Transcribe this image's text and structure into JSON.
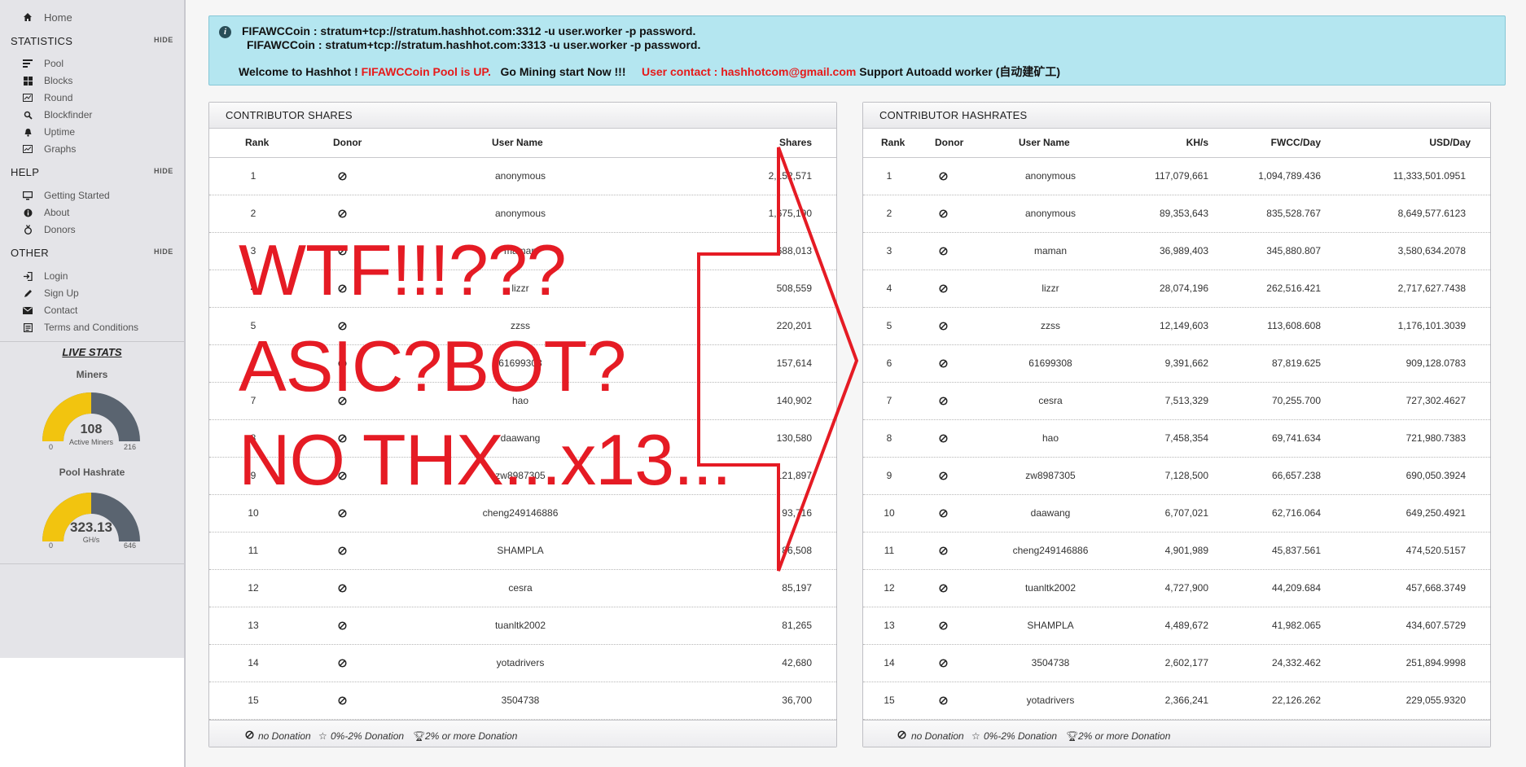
{
  "sidebar": {
    "home": "Home",
    "sections": [
      {
        "title": "STATISTICS",
        "hide": "HIDE",
        "items": [
          {
            "label": "Pool",
            "icon": "list-icon"
          },
          {
            "label": "Blocks",
            "icon": "grid-icon"
          },
          {
            "label": "Round",
            "icon": "chart-icon"
          },
          {
            "label": "Blockfinder",
            "icon": "search-icon"
          },
          {
            "label": "Uptime",
            "icon": "bell-icon"
          },
          {
            "label": "Graphs",
            "icon": "graph-icon"
          }
        ]
      },
      {
        "title": "HELP",
        "hide": "HIDE",
        "items": [
          {
            "label": "Getting Started",
            "icon": "monitor-icon"
          },
          {
            "label": "About",
            "icon": "info-icon"
          },
          {
            "label": "Donors",
            "icon": "donor-icon"
          }
        ]
      },
      {
        "title": "OTHER",
        "hide": "HIDE",
        "items": [
          {
            "label": "Login",
            "icon": "login-icon"
          },
          {
            "label": "Sign Up",
            "icon": "pencil-icon"
          },
          {
            "label": "Contact",
            "icon": "mail-icon"
          },
          {
            "label": "Terms and Conditions",
            "icon": "document-icon"
          }
        ]
      }
    ],
    "live_stats": {
      "title": "LIVE STATS",
      "miners": {
        "label": "Miners",
        "value": "108",
        "sub": "Active Miners",
        "min": "0",
        "max": "216",
        "fraction": 0.5
      },
      "hashrate": {
        "label": "Pool Hashrate",
        "value": "323.13",
        "sub": "GH/s",
        "min": "0",
        "max": "646",
        "fraction": 0.5
      }
    }
  },
  "info": {
    "line1": "FIFAWCCoin : stratum+tcp://stratum.hashhot.com:3312 -u user.worker -p password.",
    "line2": "FIFAWCCoin : stratum+tcp://stratum.hashhot.com:3313 -u user.worker -p password.",
    "welcome": "Welcome to Hashhot !",
    "pool_up": "FIFAWCCoin Pool is UP.",
    "go_mining": "Go Mining start Now !!!",
    "contact": "User contact : hashhotcom@gmail.com",
    "autoadd": "Support Autoadd worker (自动建矿工)"
  },
  "shares": {
    "title": "CONTRIBUTOR SHARES",
    "headers": {
      "rank": "Rank",
      "donor": "Donor",
      "user": "User Name",
      "shares": "Shares"
    },
    "rows": [
      {
        "rank": "1",
        "user": "anonymous",
        "shares": "2,152,571"
      },
      {
        "rank": "2",
        "user": "anonymous",
        "shares": "1,675,190"
      },
      {
        "rank": "3",
        "user": "maman",
        "shares": "688,013"
      },
      {
        "rank": "4",
        "user": "lizzr",
        "shares": "508,559"
      },
      {
        "rank": "5",
        "user": "zzss",
        "shares": "220,201"
      },
      {
        "rank": "6",
        "user": "61699308",
        "shares": "157,614"
      },
      {
        "rank": "7",
        "user": "hao",
        "shares": "140,902"
      },
      {
        "rank": "8",
        "user": "daawang",
        "shares": "130,580"
      },
      {
        "rank": "9",
        "user": "zw8987305",
        "shares": "121,897"
      },
      {
        "rank": "10",
        "user": "cheng249146886",
        "shares": "93,716"
      },
      {
        "rank": "11",
        "user": "SHAMPLA",
        "shares": "86,508"
      },
      {
        "rank": "12",
        "user": "cesra",
        "shares": "85,197"
      },
      {
        "rank": "13",
        "user": "tuanltk2002",
        "shares": "81,265"
      },
      {
        "rank": "14",
        "user": "yotadrivers",
        "shares": "42,680"
      },
      {
        "rank": "15",
        "user": "3504738",
        "shares": "36,700"
      }
    ]
  },
  "hashrates": {
    "title": "CONTRIBUTOR HASHRATES",
    "headers": {
      "rank": "Rank",
      "donor": "Donor",
      "user": "User Name",
      "khs": "KH/s",
      "per_day": "FWCC/Day",
      "usd": "USD/Day"
    },
    "rows": [
      {
        "rank": "1",
        "user": "anonymous",
        "khs": "117,079,661",
        "per_day": "1,094,789.436",
        "usd": "11,333,501.0951"
      },
      {
        "rank": "2",
        "user": "anonymous",
        "khs": "89,353,643",
        "per_day": "835,528.767",
        "usd": "8,649,577.6123"
      },
      {
        "rank": "3",
        "user": "maman",
        "khs": "36,989,403",
        "per_day": "345,880.807",
        "usd": "3,580,634.2078"
      },
      {
        "rank": "4",
        "user": "lizzr",
        "khs": "28,074,196",
        "per_day": "262,516.421",
        "usd": "2,717,627.7438"
      },
      {
        "rank": "5",
        "user": "zzss",
        "khs": "12,149,603",
        "per_day": "113,608.608",
        "usd": "1,176,101.3039"
      },
      {
        "rank": "6",
        "user": "61699308",
        "khs": "9,391,662",
        "per_day": "87,819.625",
        "usd": "909,128.0783"
      },
      {
        "rank": "7",
        "user": "cesra",
        "khs": "7,513,329",
        "per_day": "70,255.700",
        "usd": "727,302.4627"
      },
      {
        "rank": "8",
        "user": "hao",
        "khs": "7,458,354",
        "per_day": "69,741.634",
        "usd": "721,980.7383"
      },
      {
        "rank": "9",
        "user": "zw8987305",
        "khs": "7,128,500",
        "per_day": "66,657.238",
        "usd": "690,050.3924"
      },
      {
        "rank": "10",
        "user": "daawang",
        "khs": "6,707,021",
        "per_day": "62,716.064",
        "usd": "649,250.4921"
      },
      {
        "rank": "11",
        "user": "cheng249146886",
        "khs": "4,901,989",
        "per_day": "45,837.561",
        "usd": "474,520.5157"
      },
      {
        "rank": "12",
        "user": "tuanltk2002",
        "khs": "4,727,900",
        "per_day": "44,209.684",
        "usd": "457,668.3749"
      },
      {
        "rank": "13",
        "user": "SHAMPLA",
        "khs": "4,489,672",
        "per_day": "41,982.065",
        "usd": "434,607.5729"
      },
      {
        "rank": "14",
        "user": "3504738",
        "khs": "2,602,177",
        "per_day": "24,332.462",
        "usd": "251,894.9998"
      },
      {
        "rank": "15",
        "user": "yotadrivers",
        "khs": "2,366,241",
        "per_day": "22,126.262",
        "usd": "229,055.9320"
      }
    ]
  },
  "legend": {
    "none": "no Donation",
    "low": "0%-2% Donation",
    "high": "2% or more Donation"
  },
  "annotation": {
    "line1": "WTF!!!???",
    "line2": "ASIC?BOT?",
    "line3": "NO THX...x13...",
    "color": "#e51b24"
  }
}
